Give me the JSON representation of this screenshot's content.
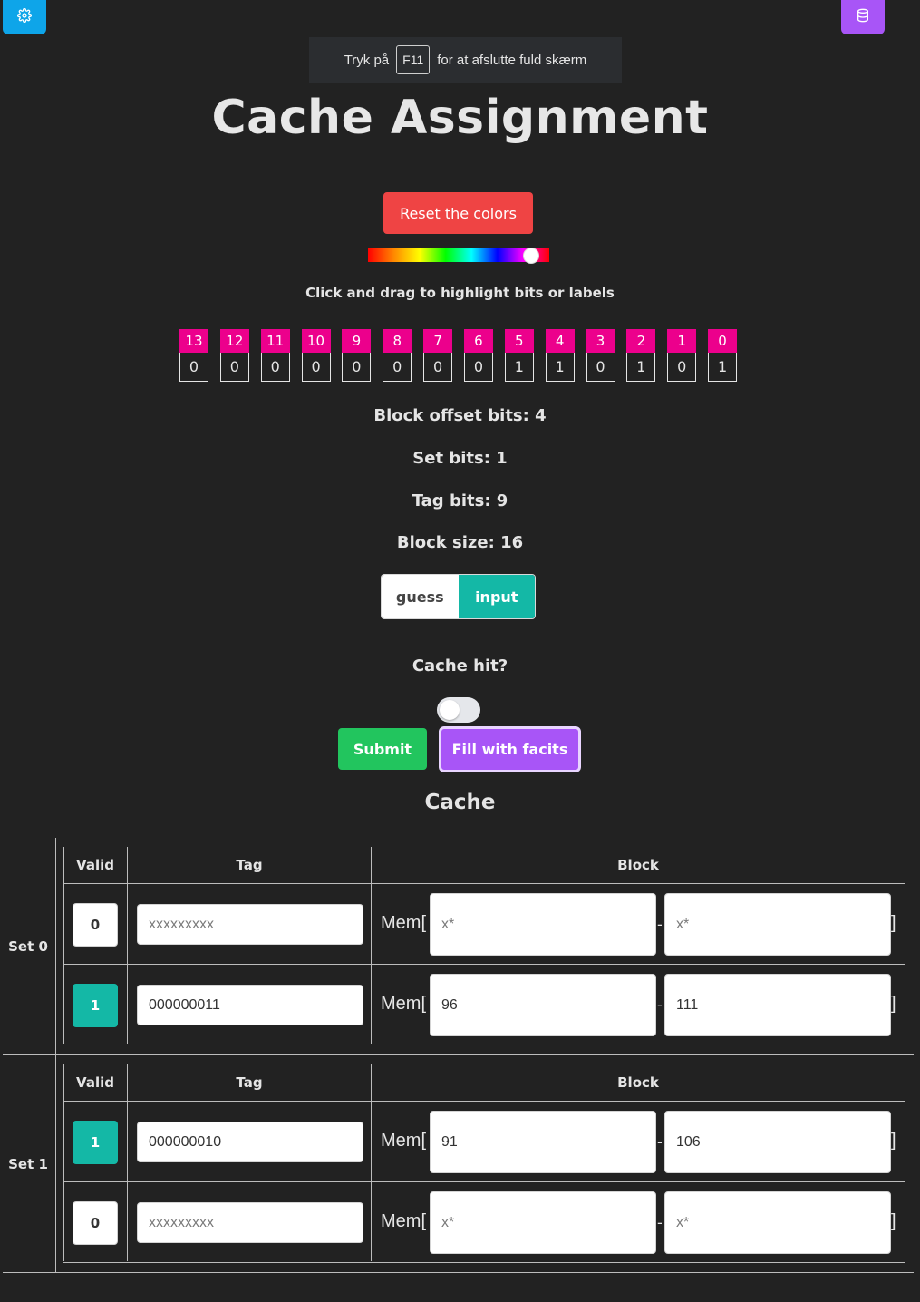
{
  "corner": {
    "settings_icon": "gear-icon",
    "database_icon": "database-icon",
    "settings_color": "#0ea5e9",
    "database_color": "#a855f7"
  },
  "fullscreen_notice": {
    "before": "Tryk på",
    "key": "F11",
    "after": "for at afslutte fuld skærm"
  },
  "title": "Cache Assignment",
  "reset_button": "Reset the colors",
  "hint": "Click and drag to highlight bits or labels",
  "bits": {
    "labels": [
      "13",
      "12",
      "11",
      "10",
      "9",
      "8",
      "7",
      "6",
      "5",
      "4",
      "3",
      "2",
      "1",
      "0"
    ],
    "values": [
      "0",
      "0",
      "0",
      "0",
      "0",
      "0",
      "0",
      "0",
      "1",
      "1",
      "0",
      "1",
      "0",
      "1"
    ],
    "label_color": "#ec008c"
  },
  "info": {
    "block_offset": "Block offset bits: 4",
    "set_bits": "Set bits: 1",
    "tag_bits": "Tag bits: 9",
    "block_size": "Block size: 16"
  },
  "mode": {
    "guess": "guess",
    "input": "input",
    "selected": "input"
  },
  "cache_hit": {
    "label": "Cache hit?",
    "checked": false
  },
  "buttons": {
    "submit": "Submit",
    "facits": "Fill with facits"
  },
  "cache": {
    "title": "Cache",
    "headers": {
      "valid": "Valid",
      "tag": "Tag",
      "block": "Block"
    },
    "mem_prefix": "Mem[",
    "mem_dash": "-",
    "mem_suffix": "]",
    "sets": [
      {
        "label": "Set 0",
        "lines": [
          {
            "valid": "0",
            "tag_value": "",
            "tag_placeholder": "xxxxxxxxx",
            "start_value": "",
            "start_placeholder": "x*",
            "end_value": "",
            "end_placeholder": "x*"
          },
          {
            "valid": "1",
            "tag_value": "000000011",
            "tag_placeholder": "xxxxxxxxx",
            "start_value": "96",
            "start_placeholder": "x*",
            "end_value": "111",
            "end_placeholder": "x*"
          }
        ]
      },
      {
        "label": "Set 1",
        "lines": [
          {
            "valid": "1",
            "tag_value": "000000010",
            "tag_placeholder": "xxxxxxxxx",
            "start_value": "91",
            "start_placeholder": "x*",
            "end_value": "106",
            "end_placeholder": "x*"
          },
          {
            "valid": "0",
            "tag_value": "",
            "tag_placeholder": "xxxxxxxxx",
            "start_value": "",
            "start_placeholder": "x*",
            "end_value": "",
            "end_placeholder": "x*"
          }
        ]
      }
    ]
  },
  "colors": {
    "background": "#222222",
    "reset": "#ef4444",
    "teal": "#14b8a6",
    "submit": "#22c55e",
    "purple": "#a855f7"
  }
}
